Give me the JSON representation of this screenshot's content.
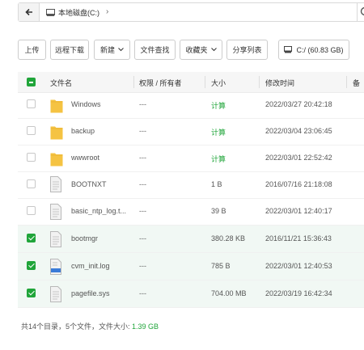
{
  "address": {
    "path": "本地磁盘(C:)",
    "separator": "›"
  },
  "toolbar": {
    "upload": "上传",
    "remote_download": "远程下载",
    "new": "新建",
    "file_search": "文件查找",
    "favorites": "收藏夹",
    "share_list": "分享列表",
    "disk": "C:/ (60.83 GB)"
  },
  "columns": {
    "name": "文件名",
    "permission": "权限 / 所有者",
    "size": "大小",
    "modified": "修改时间",
    "remark": "备"
  },
  "files": [
    {
      "name": "Windows",
      "type": "folder",
      "perm": "---",
      "size": "计算",
      "time": "2022/03/27 20:42:18",
      "checked": false
    },
    {
      "name": "backup",
      "type": "folder",
      "perm": "---",
      "size": "计算",
      "time": "2022/03/04 23:06:45",
      "checked": false
    },
    {
      "name": "wwwroot",
      "type": "folder",
      "perm": "---",
      "size": "计算",
      "time": "2022/03/01 22:52:42",
      "checked": false
    },
    {
      "name": "BOOTNXT",
      "type": "file",
      "perm": "---",
      "size": "1 B",
      "time": "2016/07/16 21:18:08",
      "checked": false
    },
    {
      "name": "basic_ntp_log.t...",
      "type": "file",
      "perm": "---",
      "size": "39 B",
      "time": "2022/03/01 12:40:17",
      "checked": false
    },
    {
      "name": "bootmgr",
      "type": "file",
      "perm": "---",
      "size": "380.28 KB",
      "time": "2016/11/21 15:36:43",
      "checked": true
    },
    {
      "name": "cvm_init.log",
      "type": "log",
      "perm": "---",
      "size": "785 B",
      "time": "2022/03/01 12:40:53",
      "checked": true
    },
    {
      "name": "pagefile.sys",
      "type": "file",
      "perm": "---",
      "size": "704.00 MB",
      "time": "2022/03/19 16:42:34",
      "checked": true
    }
  ],
  "footer": {
    "summary": "共14个目录，5个文件，文件大小: ",
    "total": "1.39 GB"
  },
  "colors": {
    "accent": "#20a53a",
    "folder": "#f5c342"
  }
}
